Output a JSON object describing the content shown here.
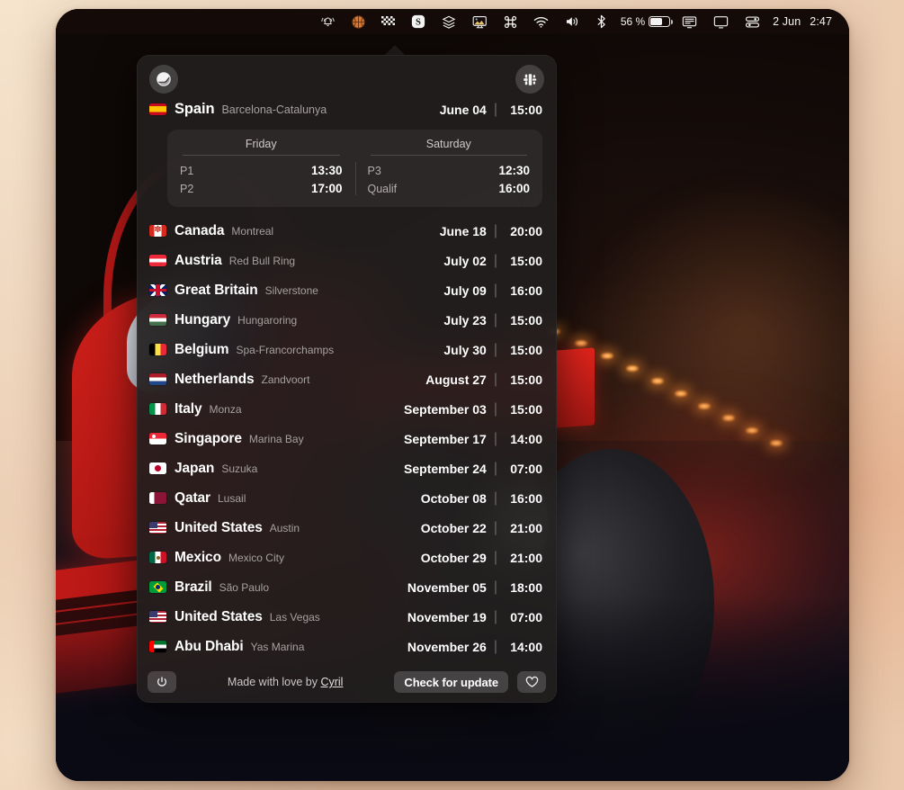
{
  "menubar": {
    "icons": [
      {
        "name": "do-not-disturb-bell-icon",
        "glyph": "bell"
      },
      {
        "name": "basketball-icon",
        "glyph": "basketball"
      },
      {
        "name": "checkered-flag-icon",
        "glyph": "checkered-flag"
      },
      {
        "name": "app-s-icon",
        "glyph": "S"
      },
      {
        "name": "layers-stack-icon",
        "glyph": "layers"
      },
      {
        "name": "display-wallpaper-icon",
        "glyph": "monitor-image"
      },
      {
        "name": "command-key-icon",
        "glyph": "command"
      },
      {
        "name": "wifi-icon",
        "glyph": "wifi"
      },
      {
        "name": "volume-icon",
        "glyph": "speaker"
      },
      {
        "name": "bluetooth-icon",
        "glyph": "bluetooth"
      }
    ],
    "battery_percent": "56 %",
    "trailing_icons": [
      {
        "name": "screen-mirroring-icon",
        "glyph": "monitor"
      },
      {
        "name": "display-icon",
        "glyph": "display"
      },
      {
        "name": "control-center-icon",
        "glyph": "control-center"
      }
    ],
    "date": "2 Jun",
    "time": "2:47"
  },
  "popover": {
    "header": {
      "helmet_button": "racing-helmet",
      "car_button": "f1-car"
    },
    "next_race": {
      "flag_class": "f-es",
      "country": "Spain",
      "circuit": "Barcelona-Catalunya",
      "date": "June 04",
      "time": "15:00",
      "separator": "|"
    },
    "sessions": [
      {
        "day": "Friday",
        "rows": [
          {
            "name": "P1",
            "time": "13:30"
          },
          {
            "name": "P2",
            "time": "17:00"
          }
        ]
      },
      {
        "day": "Saturday",
        "rows": [
          {
            "name": "P3",
            "time": "12:30"
          },
          {
            "name": "Qualif",
            "time": "16:00"
          }
        ]
      }
    ],
    "races": [
      {
        "flag_class": "f-ca",
        "country": "Canada",
        "circuit": "Montreal",
        "date": "June 18",
        "time": "20:00"
      },
      {
        "flag_class": "f-at",
        "country": "Austria",
        "circuit": "Red Bull Ring",
        "date": "July 02",
        "time": "15:00"
      },
      {
        "flag_class": "f-gb",
        "country": "Great Britain",
        "circuit": "Silverstone",
        "date": "July 09",
        "time": "16:00"
      },
      {
        "flag_class": "f-hu",
        "country": "Hungary",
        "circuit": "Hungaroring",
        "date": "July 23",
        "time": "15:00"
      },
      {
        "flag_class": "f-be",
        "country": "Belgium",
        "circuit": "Spa-Francorchamps",
        "date": "July 30",
        "time": "15:00"
      },
      {
        "flag_class": "f-nl",
        "country": "Netherlands",
        "circuit": "Zandvoort",
        "date": "August 27",
        "time": "15:00"
      },
      {
        "flag_class": "f-it",
        "country": "Italy",
        "circuit": "Monza",
        "date": "September 03",
        "time": "15:00"
      },
      {
        "flag_class": "f-sg",
        "country": "Singapore",
        "circuit": "Marina Bay",
        "date": "September 17",
        "time": "14:00"
      },
      {
        "flag_class": "f-jp",
        "country": "Japan",
        "circuit": "Suzuka",
        "date": "September 24",
        "time": "07:00"
      },
      {
        "flag_class": "f-qa",
        "country": "Qatar",
        "circuit": "Lusail",
        "date": "October 08",
        "time": "16:00"
      },
      {
        "flag_class": "f-us",
        "country": "United States",
        "circuit": "Austin",
        "date": "October 22",
        "time": "21:00"
      },
      {
        "flag_class": "f-mx",
        "country": "Mexico",
        "circuit": "Mexico City",
        "date": "October 29",
        "time": "21:00"
      },
      {
        "flag_class": "f-br",
        "country": "Brazil",
        "circuit": "São Paulo",
        "date": "November 05",
        "time": "18:00"
      },
      {
        "flag_class": "f-us",
        "country": "United States",
        "circuit": "Las Vegas",
        "date": "November 19",
        "time": "07:00"
      },
      {
        "flag_class": "f-ae",
        "country": "Abu Dhabi",
        "circuit": "Yas Marina",
        "date": "November 26",
        "time": "14:00"
      }
    ],
    "footer": {
      "power_label": "quit",
      "credit_prefix": "Made with love by",
      "credit_author": "Cyril",
      "update_label": "Check for update",
      "heart_label": "support"
    }
  },
  "colors": {
    "panel_bg": "#221e1e",
    "accent_red": "#c41a18",
    "text_primary": "#ffffff",
    "text_secondary": "#a6a19f",
    "desktop_bg": "#efd8c0"
  }
}
